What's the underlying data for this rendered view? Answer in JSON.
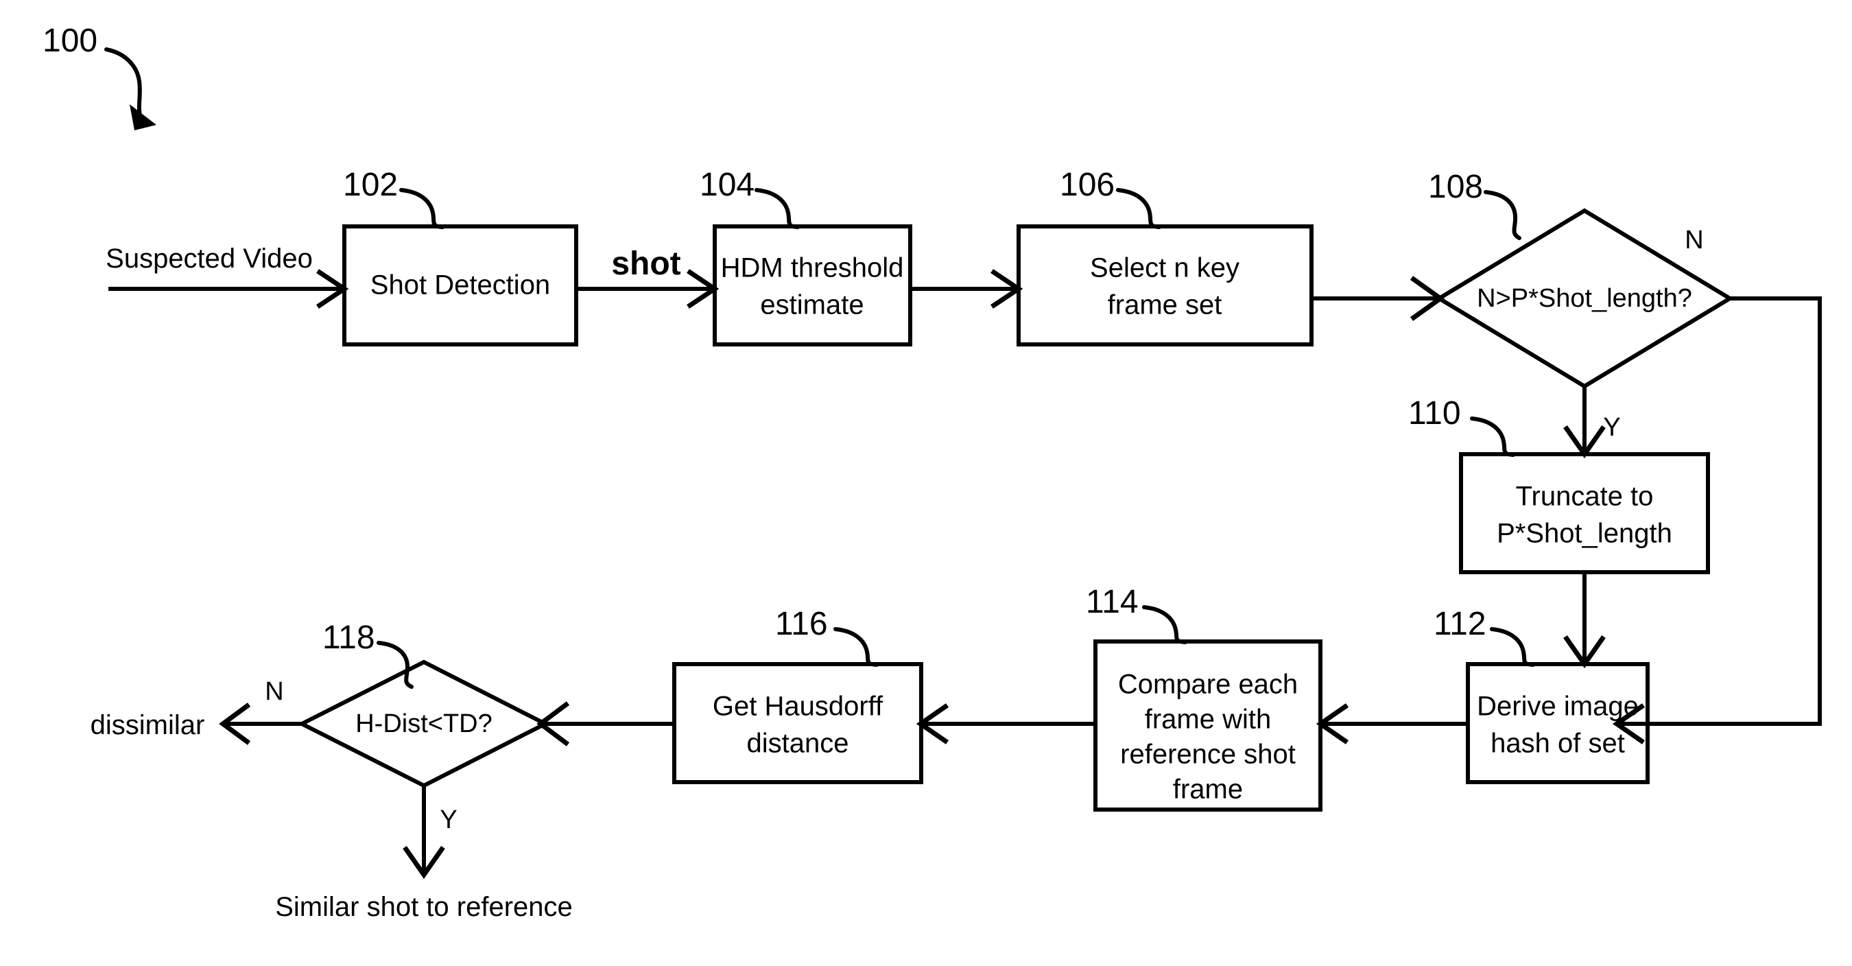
{
  "figure": {
    "figure_number": "100",
    "title": "Video shot similarity detection flowchart",
    "background_color": "#ffffff",
    "line_color": "#000000"
  },
  "inputs": {
    "suspected_video": "Suspected Video"
  },
  "outputs": {
    "dissimilar": "dissimilar",
    "similar": "Similar shot to reference"
  },
  "edge_labels": {
    "shot": "shot",
    "yes_108": "Y",
    "no_108": "N",
    "yes_118": "Y",
    "no_118": "N"
  },
  "nodes": [
    {
      "ref": "102",
      "kind": "process",
      "lines": [
        "Shot Detection"
      ]
    },
    {
      "ref": "104",
      "kind": "process",
      "lines": [
        "HDM threshold",
        "estimate"
      ]
    },
    {
      "ref": "106",
      "kind": "process",
      "lines": [
        "Select n key",
        "frame set"
      ]
    },
    {
      "ref": "108",
      "kind": "decision",
      "lines": [
        "N>P*Shot_length?"
      ]
    },
    {
      "ref": "110",
      "kind": "process",
      "lines": [
        "Truncate to",
        "P*Shot_length"
      ]
    },
    {
      "ref": "112",
      "kind": "process",
      "lines": [
        "Derive image",
        "hash of set"
      ]
    },
    {
      "ref": "114",
      "kind": "process",
      "lines": [
        "Compare each",
        "frame with",
        "reference shot",
        "frame"
      ]
    },
    {
      "ref": "116",
      "kind": "process",
      "lines": [
        "Get Hausdorff",
        "distance"
      ]
    },
    {
      "ref": "118",
      "kind": "decision",
      "lines": [
        "H-Dist<TD?"
      ]
    }
  ]
}
